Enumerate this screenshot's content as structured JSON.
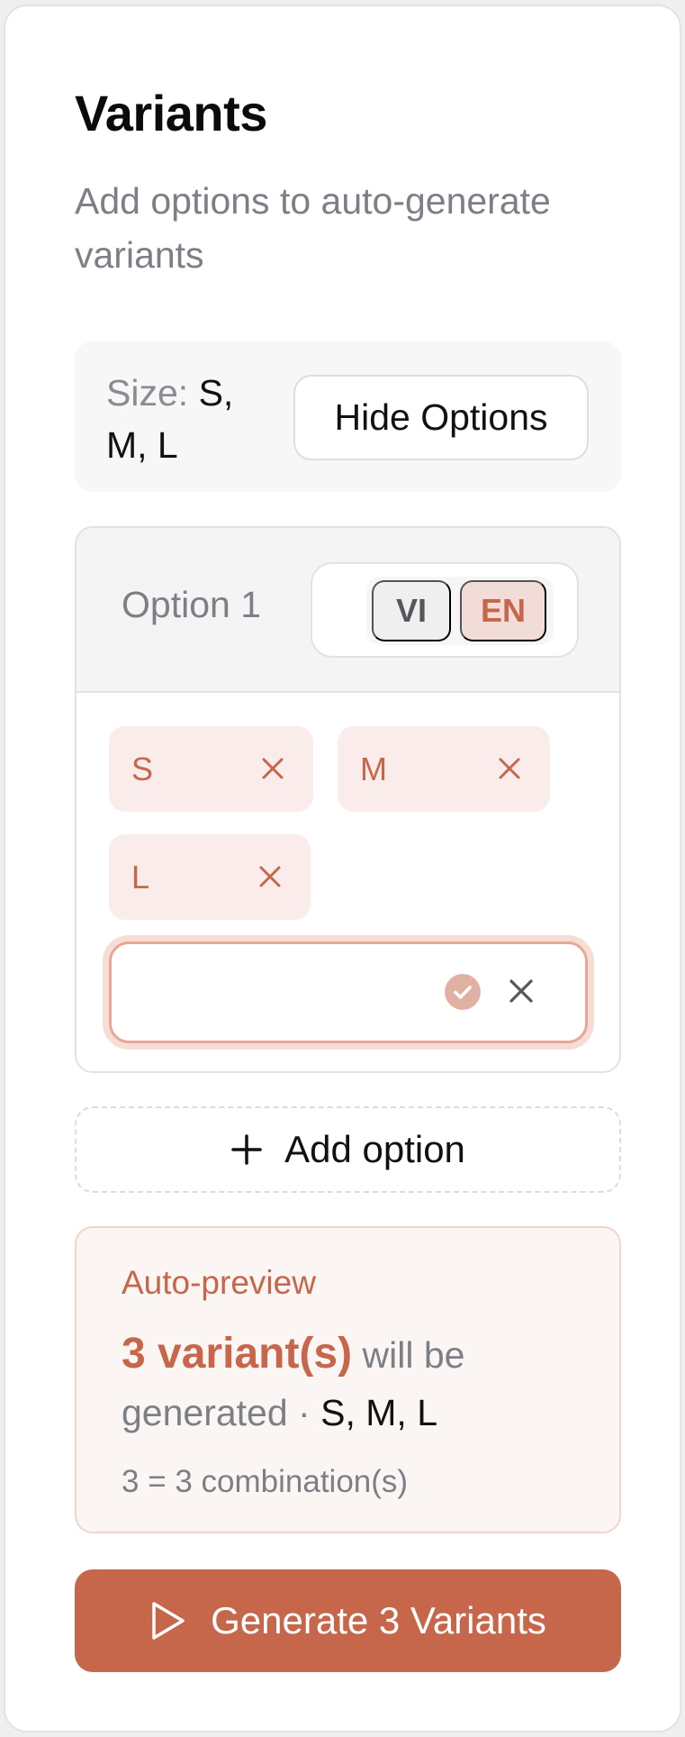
{
  "header": {
    "title": "Variants",
    "subtitle": "Add options to auto-generate variants"
  },
  "summary": {
    "key": "Size:",
    "values": "S, M, L",
    "toggle_label": "Hide Options"
  },
  "option": {
    "name": "Option 1",
    "languages": [
      "VI",
      "EN"
    ],
    "active_language": "EN",
    "values": [
      "S",
      "M",
      "L"
    ],
    "new_value_input": ""
  },
  "add_option_label": "Add option",
  "preview": {
    "title": "Auto-preview",
    "count_text": "3 variant(s)",
    "will_be_text": "will be generated ·",
    "values": "S, M, L",
    "combination_text": "3 = 3 combination(s)"
  },
  "generate_label": "Generate 3 Variants",
  "colors": {
    "accent": "#c6674c",
    "chip_bg": "#f9ecea",
    "muted_text": "#7d7f86"
  },
  "icons": {
    "chip_remove": "close-icon",
    "confirm": "check-circle-icon",
    "cancel": "close-icon",
    "add": "plus-icon",
    "generate": "play-icon"
  }
}
